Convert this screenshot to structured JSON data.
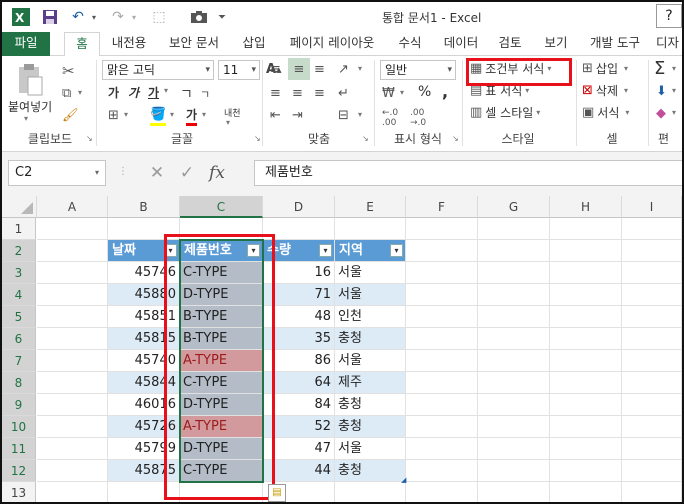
{
  "window": {
    "title": "통합 문서1 - Excel",
    "minimize_label": "?"
  },
  "tabs": [
    "파일",
    "홈",
    "내전용",
    "보안 문서",
    "삽입",
    "페이지 레이아웃",
    "수식",
    "데이터",
    "검토",
    "보기",
    "개발 도구",
    "디자"
  ],
  "ribbon": {
    "clipboard": {
      "paste_label": "붙여넣기",
      "group_label": "클립보드"
    },
    "font": {
      "name": "맑은 고딕",
      "size": "11",
      "bold": "가",
      "italic": "가",
      "underline": "가",
      "fontcolor": "가",
      "phonetic": "내천",
      "group_label": "글꼴"
    },
    "alignment": {
      "group_label": "맞춤"
    },
    "number": {
      "format": "일반",
      "percent": "%",
      "comma": ",",
      "group_label": "표시 형식"
    },
    "styles": {
      "conditional": "조건부 서식",
      "table": "표 서식",
      "cell": "셀 스타일",
      "group_label": "스타일"
    },
    "cells": {
      "insert": "삽입",
      "delete": "삭제",
      "format": "서식",
      "group_label": "셀"
    },
    "editing": {
      "sum": "Σ",
      "group_label": "편"
    }
  },
  "formula_bar": {
    "name_box": "C2",
    "cancel": "✕",
    "enter": "✓",
    "fx": "fx",
    "value": "제품번호"
  },
  "columns": [
    "A",
    "B",
    "C",
    "D",
    "E",
    "F",
    "G",
    "H",
    "I"
  ],
  "rows": [
    "1",
    "2",
    "3",
    "4",
    "5",
    "6",
    "7",
    "8",
    "9",
    "10",
    "11",
    "12",
    "13"
  ],
  "table": {
    "headers": [
      "날짜",
      "제품번호",
      "수량",
      "지역"
    ],
    "rows": [
      {
        "date": "45746",
        "product": "C-TYPE",
        "qty": "16",
        "region": "서울"
      },
      {
        "date": "45880",
        "product": "D-TYPE",
        "qty": "71",
        "region": "서울"
      },
      {
        "date": "45851",
        "product": "B-TYPE",
        "qty": "48",
        "region": "인천"
      },
      {
        "date": "45815",
        "product": "B-TYPE",
        "qty": "35",
        "region": "충청"
      },
      {
        "date": "45740",
        "product": "A-TYPE",
        "qty": "86",
        "region": "서울"
      },
      {
        "date": "45844",
        "product": "C-TYPE",
        "qty": "64",
        "region": "제주"
      },
      {
        "date": "46016",
        "product": "D-TYPE",
        "qty": "84",
        "region": "충청"
      },
      {
        "date": "45726",
        "product": "A-TYPE",
        "qty": "52",
        "region": "충청"
      },
      {
        "date": "45799",
        "product": "D-TYPE",
        "qty": "47",
        "region": "서울"
      },
      {
        "date": "45875",
        "product": "C-TYPE",
        "qty": "44",
        "region": "충청"
      }
    ]
  },
  "colors": {
    "excel_green": "#217346",
    "table_header": "#5b9bd5",
    "band": "#ddebf7",
    "highlight_red": "#e8101b"
  },
  "icons": [
    "excel-icon",
    "save-icon",
    "undo-icon",
    "redo-icon",
    "camera-icon",
    "paste-icon",
    "cut-icon",
    "copy-icon",
    "format-painter-icon",
    "fill-color-icon",
    "font-color-icon",
    "filter-dropdown-icon",
    "quick-analysis-icon",
    "sum-icon"
  ]
}
